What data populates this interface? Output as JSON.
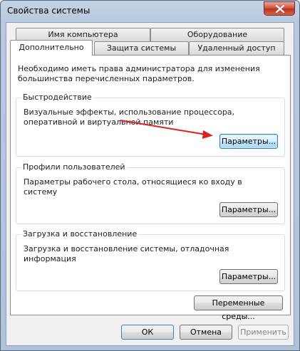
{
  "window": {
    "title": "Свойства системы"
  },
  "tabs": {
    "row1": [
      "Имя компьютера",
      "Оборудование"
    ],
    "row2": [
      "Дополнительно",
      "Защита системы",
      "Удаленный доступ"
    ]
  },
  "notice": "Необходимо иметь права администратора для изменения большинства перечисленных параметров.",
  "performance": {
    "title": "Быстродействие",
    "description": "Визуальные эффекты, использование процессора, оперативной и виртуальной памяти",
    "button": "Параметры..."
  },
  "profiles": {
    "title": "Профили пользователей",
    "description": "Параметры рабочего стола, относящиеся ко входу в систему",
    "button": "Параметры..."
  },
  "startup": {
    "title": "Загрузка и восстановление",
    "description": "Загрузка и восстановление системы, отладочная информация",
    "button": "Параметры..."
  },
  "env_button": "Переменные среды...",
  "footer": {
    "ok": "ОК",
    "cancel": "Отмена",
    "apply": "Применить"
  },
  "colors": {
    "arrow": "#e02020",
    "focus_border": "#3c7fb1",
    "close_button": "#cf4b36"
  }
}
